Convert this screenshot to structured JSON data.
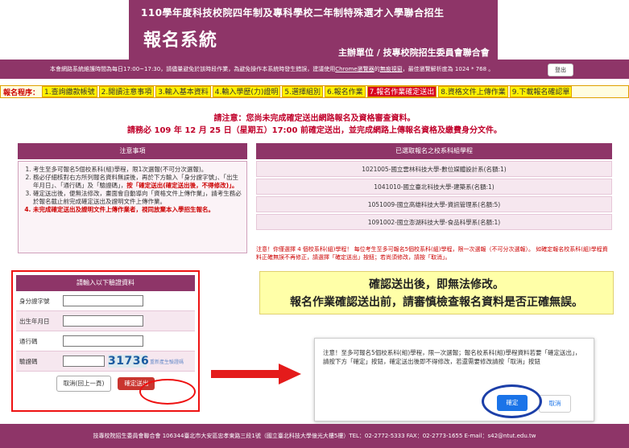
{
  "header": {
    "title": "110學年度科技校院四年制及專科學校二年制特殊選才入學聯合招生",
    "system": "報名系統",
    "org": "主辦單位 / 技專校院招生委員會聯合會"
  },
  "notice_bar": {
    "text_before": "本會網路系統維護時間為每日17:00~17:30，請儘量避免於該時段作業，為避免操作本系統時發生錯誤，建議使用",
    "link1": "Chrome瀏覽器",
    "text_mid": "的",
    "link2": "無痕視窗",
    "text_after": "，最佳瀏覽解析度為 1024 * 768 。",
    "logout": "登出"
  },
  "steps": {
    "label": "報名程序：",
    "items": [
      "1.查詢繳款帳號",
      "2.閱讀注意事項",
      "3.輸入基本資料",
      "4.輸入學歷(力)證明",
      "5.選擇組別",
      "6.報名作業",
      "7.報名作業確定送出",
      "8.資格文件上傳作業",
      "9.下載報名確認單"
    ],
    "active_index": 6
  },
  "warning": {
    "line1": "請注意：您尚未完成確定送出網路報名及資格審查資料。",
    "line2": "請務必 109 年 12 月 25 日（星期五）17:00 前確定送出，並完成網路上傳報名資格及繳費身分文件。"
  },
  "notes": {
    "header": "注意事項",
    "items": [
      "考生至多可報名5個校系科(組)學程，限1次選報(不可分次選報)。",
      "務必仔細核對右方所列報名資料無誤後，再於下方輸入「身分證字號」、「出生年月日」、「通行碼」及「驗證碼」，按「確定送出(確定送出後，不得修改)」。",
      "確定送出後，便無法修改，畫面會自動導向「資格文件上傳作業」，請考生務必於報名截止前完成確定送出及證明文件上傳作業。",
      "未完成確定送出及證明文件上傳作業者，視同放棄本入學招生報名。"
    ],
    "red_fragment_2": "按「確定送出(確定送出後，不得修改)」。",
    "item4_red": true
  },
  "selected": {
    "header": "已選取報名之校系科組學程",
    "rows": [
      "1021005-國立雲林科技大學-數位媒體設計系(名額:1)",
      "1041010-國立臺北科技大學-建築系(名額:1)",
      "1051009-國立高雄科技大學-資訊管理系(名額:5)",
      "1091002-國立澎湖科技大學-食品科學系(名額:1)"
    ],
    "note": "注意！你僅選擇 4 個校系科(組)學程！ 每位考生至多可報名5個校系科(組)學程，限一次選報（不可分次選報）。 如確定報名校系科(組)學程資料正確無誤不再修正，請選擇「確定送出」按鈕；若尚須修改，請按「取消」。"
  },
  "login": {
    "header": "請輸入以下驗證資料",
    "id_label": "身分證字號",
    "birth_label": "出生年月日",
    "pass_label": "通行碼",
    "captcha_label": "驗證碼",
    "captcha_value": "31736",
    "refresh": "重新產生驗證碼",
    "cancel_btn": "取消(回上一頁)",
    "submit_btn": "確定送出"
  },
  "big_warning": {
    "line1": "確認送出後，即無法修改。",
    "line2": "報名作業確認送出前，請審慎檢查報名資料是否正確無誤。"
  },
  "dialog": {
    "text": "注意！至多可報名5個校系科(組)學程，限一次選報；報名校系科(組)學程資料若要「確定送出」，請按下方「確定」按鈕，確定送出後即不得修改，若還需要修改請按「取消」按鈕",
    "ok": "確定",
    "cancel": "取消"
  },
  "footer": {
    "text": "技專校院招生委員會聯合會 106344臺北市大安區忠孝東路三段1號（國立臺北科技大學億光大樓5樓）TEL：02-2772-5333 FAX：02-2773-1655 E-mail：s42@ntut.edu.tw"
  }
}
